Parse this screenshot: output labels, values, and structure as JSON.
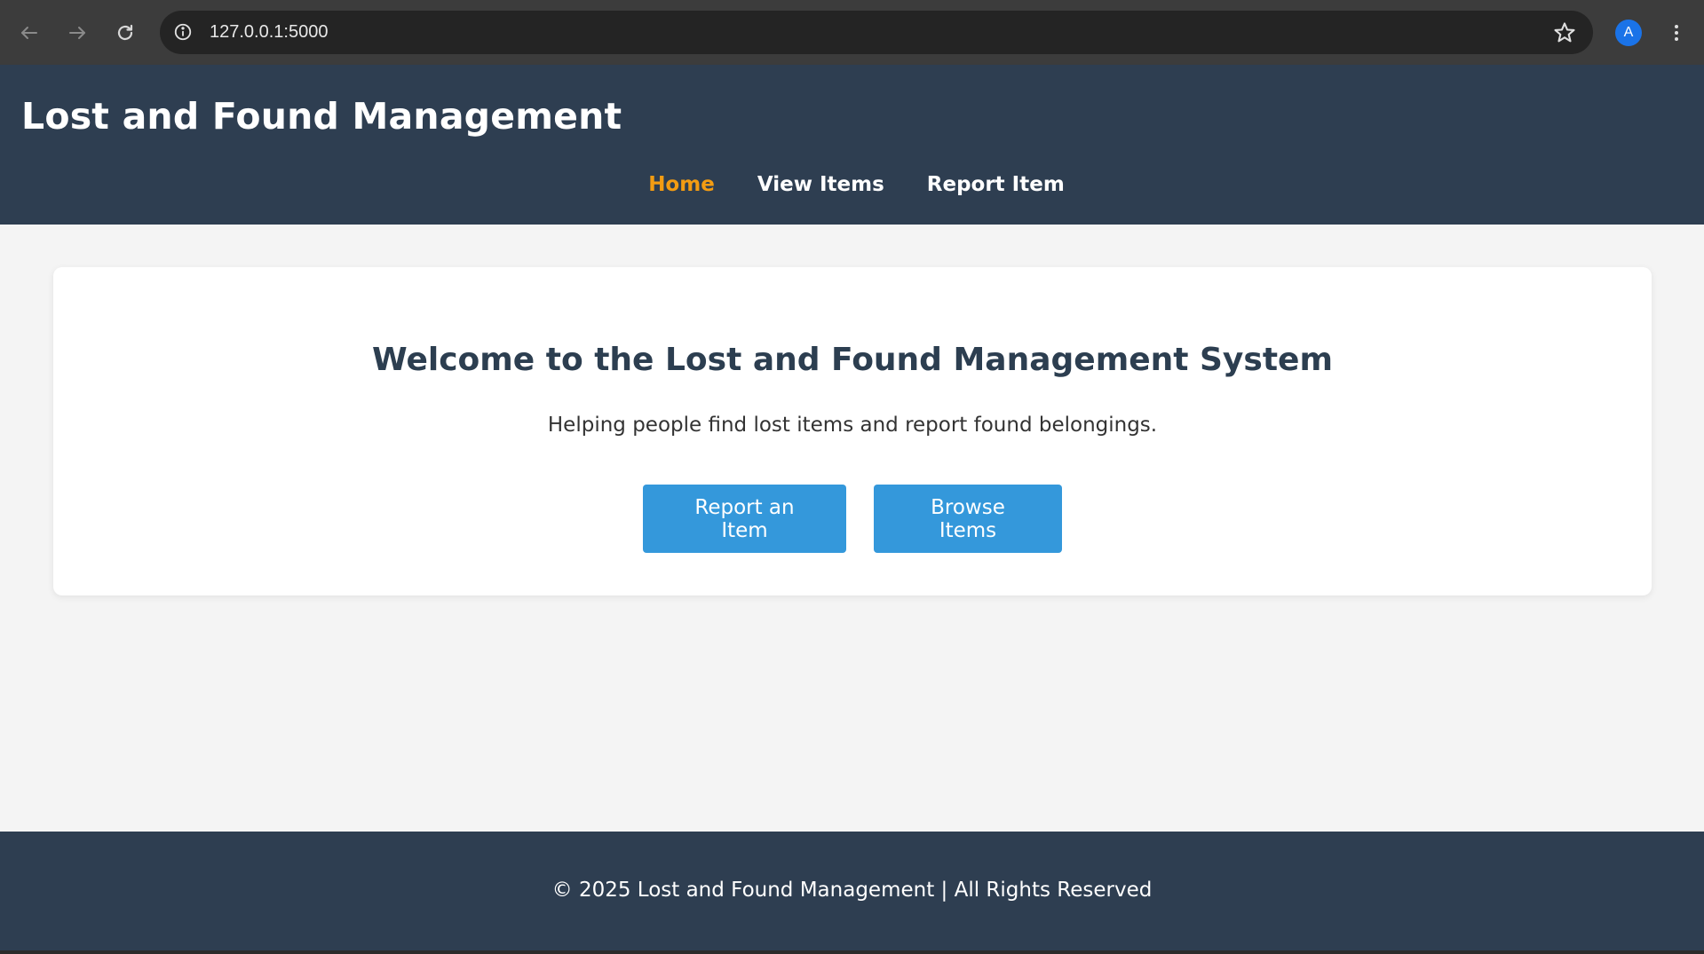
{
  "browser": {
    "url": "127.0.0.1:5000",
    "profile_initial": "A",
    "icons": {
      "back": "arrow-left-icon",
      "forward": "arrow-right-icon",
      "reload": "reload-icon",
      "site_info": "info-icon",
      "bookmark": "star-icon",
      "menu": "more-vertical-icon"
    }
  },
  "header": {
    "title": "Lost and Found Management",
    "nav": [
      {
        "label": "Home",
        "active": true
      },
      {
        "label": "View Items",
        "active": false
      },
      {
        "label": "Report Item",
        "active": false
      }
    ]
  },
  "main": {
    "heading": "Welcome to the Lost and Found Management System",
    "subtitle": "Helping people find lost items and report found belongings.",
    "buttons": {
      "report": "Report an Item",
      "browse": "Browse Items"
    }
  },
  "footer": {
    "text": "© 2025 Lost and Found Management | All Rights Reserved"
  },
  "colors": {
    "header_bg": "#2e3e51",
    "accent_active": "#f39c12",
    "button_bg": "#3498db",
    "page_bg": "#f4f4f4",
    "heading_text": "#2c3e50"
  }
}
